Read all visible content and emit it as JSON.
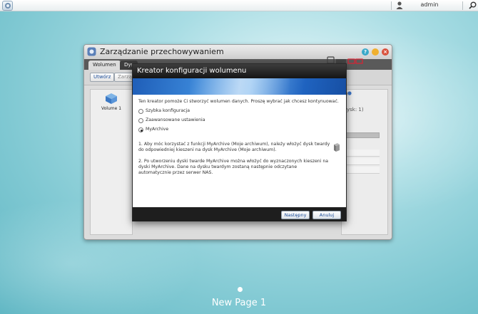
{
  "topbar": {
    "username": "admin"
  },
  "storage_window": {
    "title": "Zarządzanie przechowywaniem",
    "tabs": [
      "Wolumen",
      "Dys"
    ],
    "toolbar": {
      "create_label": "Utwórz",
      "manage_label": "Zarządz"
    },
    "volume_label": "Volume 1",
    "info_a": "s)",
    "info_b": "ysk: 1)"
  },
  "wizard": {
    "title": "Kreator konfiguracji wolumenu",
    "intro": "Ten kreator pomoże Ci stworzyć wolumen danych. Proszę wybrać jak chcesz kontynuować.",
    "options": [
      {
        "label": "Szybka konfiguracja",
        "checked": false
      },
      {
        "label": "Zaawansowane ustawienia",
        "checked": false
      },
      {
        "label": "MyArchive",
        "checked": true
      }
    ],
    "note1": "1. Aby móc korzystać z funkcji MyArchive (Moje archiwum), należy włożyć dysk twardy do odpowiedniej kieszeni na dysk MyArchive (Moje archiwum).",
    "note2": "2. Po utworzeniu dyski twarde MyArchive można włożyć do wyznaczonych kieszeni na dyski MyArchive. Dane na dysku twardym zostaną następnie odczytane automatycznie przez serwer NAS.",
    "next_label": "Następny",
    "cancel_label": "Anuluj"
  },
  "desktop": {
    "page_label": "New Page 1"
  },
  "colors": {
    "accent": "#1f5eb8",
    "title_bar": "#151515",
    "desktop": "#a9dde4"
  }
}
